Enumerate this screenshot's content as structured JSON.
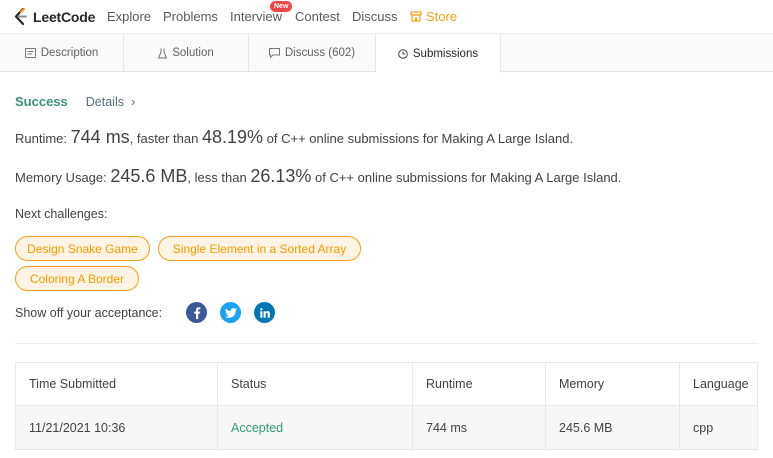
{
  "nav": {
    "brand": "LeetCode",
    "items": [
      "Explore",
      "Problems",
      "Interview",
      "Contest",
      "Discuss"
    ],
    "interview_badge": "New",
    "store": "Store"
  },
  "tabs": [
    {
      "label": "Description",
      "icon": "document-icon"
    },
    {
      "label": "Solution",
      "icon": "flask-icon"
    },
    {
      "label": "Discuss (602)",
      "icon": "comment-icon"
    },
    {
      "label": "Submissions",
      "icon": "clock-icon",
      "active": true
    }
  ],
  "result": {
    "status": "Success",
    "details": "Details",
    "chevron": "›"
  },
  "runtime": {
    "label": "Runtime:",
    "value": "744 ms",
    "mid": ", faster than",
    "percent": "48.19%",
    "tail": "of C++ online submissions for Making A Large Island."
  },
  "memory": {
    "label": "Memory Usage:",
    "value": "245.6 MB",
    "mid": ", less than",
    "percent": "26.13%",
    "tail": "of C++ online submissions for Making A Large Island."
  },
  "next": {
    "label": "Next challenges:",
    "items": [
      "Design Snake Game",
      "Single Element in a Sorted Array",
      "Coloring A Border"
    ]
  },
  "share": {
    "label": "Show off your acceptance:",
    "icons": [
      "facebook-icon",
      "twitter-icon",
      "linkedin-icon"
    ],
    "colors": {
      "facebook": "#3b5998",
      "twitter": "#1da1f2",
      "linkedin": "#0077b5"
    }
  },
  "table": {
    "headers": [
      "Time Submitted",
      "Status",
      "Runtime",
      "Memory",
      "Language"
    ],
    "rows": [
      [
        "11/21/2021 10:36",
        "Accepted",
        "744 ms",
        "245.6 MB",
        "cpp"
      ]
    ]
  },
  "colors": {
    "accent_orange": "#f8a01a",
    "success_green": "#3e8e7e",
    "accepted_green": "#2e9f75",
    "badge_red": "#ef4743"
  }
}
